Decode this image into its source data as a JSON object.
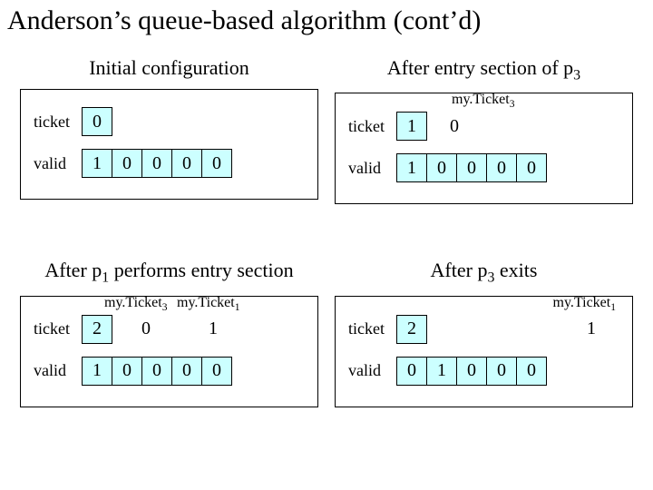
{
  "title": "Anderson’s queue-based algorithm (cont’d)",
  "panels": {
    "tl": {
      "caption": "Initial configuration",
      "ticket_label": "ticket",
      "ticket_value": "0",
      "valid_label": "valid",
      "valid": [
        "1",
        "0",
        "0",
        "0",
        "0"
      ]
    },
    "tr": {
      "caption_prefix": "After entry section of p",
      "caption_sub": "3",
      "annot1_prefix": "my.Ticket",
      "annot1_sub": "3",
      "ticket_label": "ticket",
      "ticket_value": "1",
      "extra_value": "0",
      "valid_label": "valid",
      "valid": [
        "1",
        "0",
        "0",
        "0",
        "0"
      ]
    },
    "bl": {
      "caption_prefix": "After p",
      "caption_sub": "1",
      "caption_suffix": " performs entry section",
      "annot1_prefix": "my.Ticket",
      "annot1_sub": "3",
      "annot2_prefix": "my.Ticket",
      "annot2_sub": "1",
      "ticket_label": "ticket",
      "ticket_value": "2",
      "extra1": "0",
      "extra2": "1",
      "valid_label": "valid",
      "valid": [
        "1",
        "0",
        "0",
        "0",
        "0"
      ]
    },
    "br": {
      "caption_prefix": "After p",
      "caption_sub": "3",
      "caption_suffix": " exits",
      "annot1_prefix": "my.Ticket",
      "annot1_sub": "1",
      "ticket_label": "ticket",
      "ticket_value": "2",
      "extra_value": "1",
      "valid_label": "valid",
      "valid": [
        "0",
        "1",
        "0",
        "0",
        "0"
      ]
    }
  }
}
